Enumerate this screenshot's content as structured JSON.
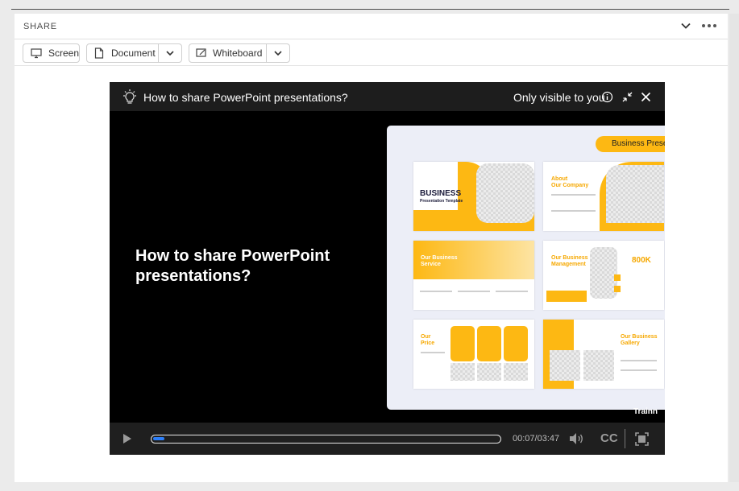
{
  "panel": {
    "title": "SHARE",
    "header_icons": [
      "chevron-down-icon",
      "more-icon"
    ]
  },
  "toolbar": {
    "screen_label": "Screen",
    "document_label": "Document",
    "whiteboard_label": "Whiteboard"
  },
  "video": {
    "title": "How to share PowerPoint presentations?",
    "visibility": "Only visible to you",
    "overlay_title": "How to share PowerPoint presentations?",
    "brand": "Trainn",
    "time": "00:07/03:47",
    "progress": 0.032,
    "cc_label": "CC"
  },
  "thumbnail": {
    "pill": "Business Prese",
    "slide1_title": "BUSINESS",
    "slide1_sub": "Presentation Template",
    "slide2_title": "About",
    "slide2_title2": "Our Company",
    "slide3_title": "Our Business",
    "slide3_title2": "Service",
    "slide4_title": "Our Business",
    "slide4_title2": "Management",
    "slide4_stat": "800K",
    "slide5_title": "Our",
    "slide5_title2": "Price",
    "slide6_title": "Our Business",
    "slide6_title2": "Gallery"
  },
  "colors": {
    "accent": "#fdb813",
    "progress": "#2d7ff9",
    "video_bg": "#000000"
  }
}
